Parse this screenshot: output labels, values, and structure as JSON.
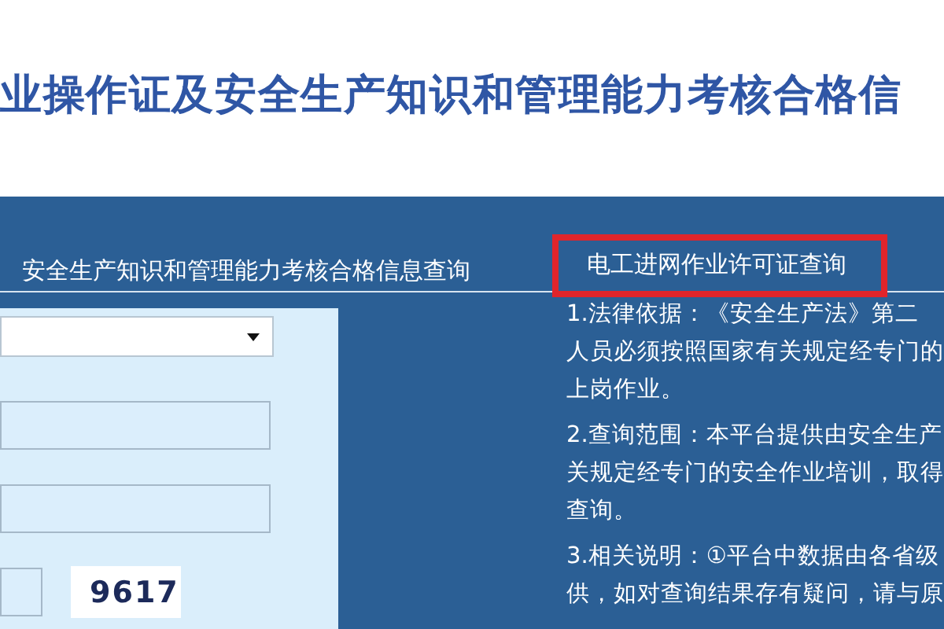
{
  "header": {
    "title": "业操作证及安全生产知识和管理能力考核合格信"
  },
  "tabs": [
    {
      "label": "安全生产知识和管理能力考核合格信息查询",
      "highlighted": false
    },
    {
      "label": "电工进网作业许可证查询",
      "highlighted": true
    }
  ],
  "form": {
    "captcha": "9617"
  },
  "notes": [
    [
      "1.法律依据：《安全生产法》第二",
      "人员必须按照国家有关规定经专门的",
      "上岗作业。"
    ],
    [
      "2.查询范围：本平台提供由安全生产",
      "关规定经专门的安全作业培训，取得",
      "查询。"
    ],
    [
      "3.相关说明：①平台中数据由各省级",
      "供，如对查询结果存有疑问，请与原"
    ]
  ]
}
